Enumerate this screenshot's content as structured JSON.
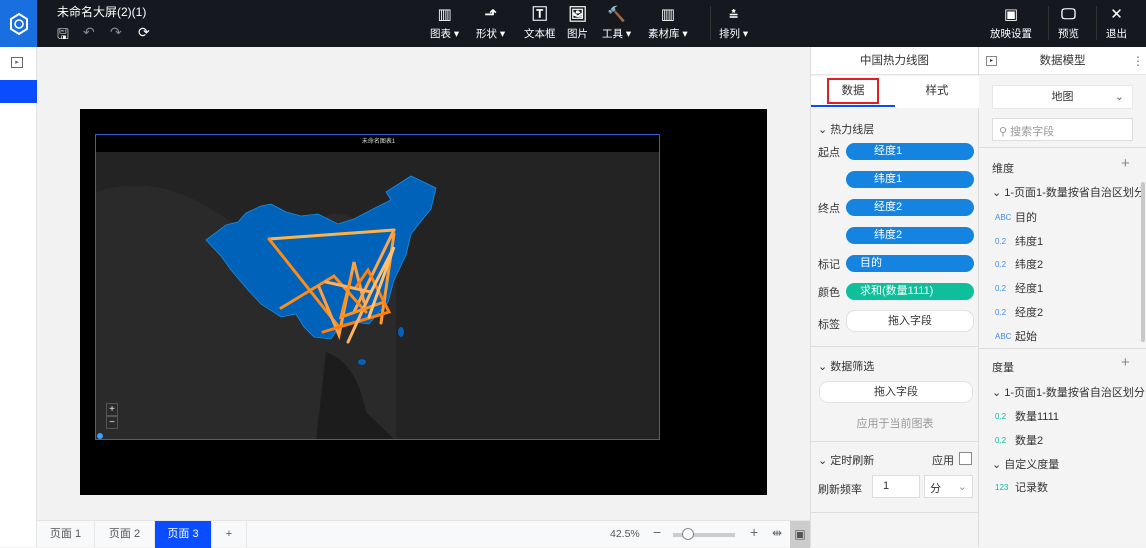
{
  "app": {
    "title": "未命名大屏(2)(1)"
  },
  "toolbar": {
    "items": [
      {
        "label": "图表",
        "icon": "bar-chart-icon"
      },
      {
        "label": "形状",
        "icon": "shape-icon"
      },
      {
        "label": "文本框",
        "icon": "textbox-icon"
      },
      {
        "label": "图片",
        "icon": "image-icon"
      },
      {
        "label": "工具",
        "icon": "tool-icon"
      },
      {
        "label": "素材库",
        "icon": "material-icon"
      },
      {
        "label": "排列",
        "icon": "arrange-icon"
      }
    ],
    "right": [
      {
        "label": "放映设置",
        "icon": "play-icon"
      },
      {
        "label": "预览",
        "icon": "preview-icon"
      },
      {
        "label": "退出",
        "icon": "close-icon"
      }
    ]
  },
  "chart": {
    "title": "未命名图表1",
    "zoom_in": "+",
    "zoom_out": "−"
  },
  "pages": {
    "tabs": [
      "页面 1",
      "页面 2",
      "页面 3"
    ],
    "active": 2,
    "add": "+",
    "zoom": "42.5%",
    "zoom_value": 0.425
  },
  "properties": {
    "title": "中国热力线图",
    "tabs": [
      "数据",
      "样式"
    ],
    "layer": "热力线层",
    "fields": [
      {
        "label": "起点",
        "value": "经度1"
      },
      {
        "label": "",
        "value": "纬度1"
      },
      {
        "label": "终点",
        "value": "经度2"
      },
      {
        "label": "",
        "value": "纬度2"
      },
      {
        "label": "标记",
        "value": "目的"
      },
      {
        "label": "颜色",
        "value": "求和(数量1111)"
      },
      {
        "label": "标签",
        "value": "拖入字段"
      }
    ],
    "filter": {
      "title": "数据筛选",
      "drop": "拖入字段",
      "apply": "应用于当前图表"
    },
    "refresh": {
      "title": "定时刷新",
      "apply": "应用",
      "freq_label": "刷新频率",
      "freq_value": "1",
      "unit": "分"
    }
  },
  "model": {
    "title": "数据模型",
    "dataset": "地图",
    "search_placeholder": "搜索字段",
    "dimensions_title": "维度",
    "group": "1-页面1-数量按省自治区划分",
    "dimensions": [
      {
        "type": "ABC",
        "name": "目的"
      },
      {
        "type": "0.2",
        "name": "纬度1"
      },
      {
        "type": "0.2",
        "name": "纬度2"
      },
      {
        "type": "0.2",
        "name": "经度1"
      },
      {
        "type": "0.2",
        "name": "经度2"
      },
      {
        "type": "ABC",
        "name": "起始"
      }
    ],
    "measures_title": "度量",
    "measure_group": "1-页面1-数量按省自治区划分",
    "measures": [
      {
        "type": "0.2",
        "name": "数量1111"
      },
      {
        "type": "0.2",
        "name": "数量2"
      }
    ],
    "custom_group": "自定义度量",
    "custom": [
      {
        "type": "123",
        "name": "记录数"
      }
    ]
  }
}
